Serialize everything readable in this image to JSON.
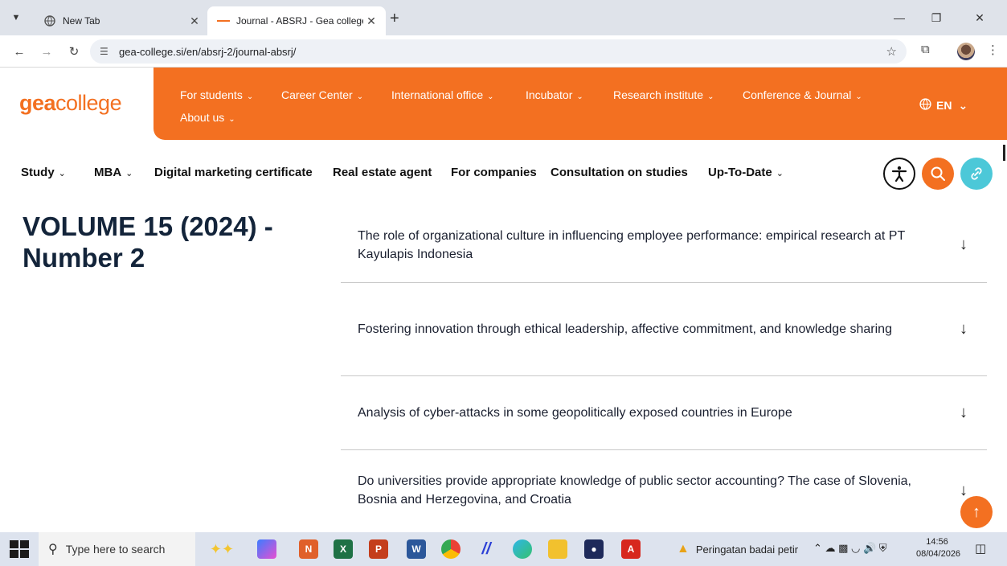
{
  "browser": {
    "tabs": [
      {
        "title": "New Tab"
      },
      {
        "title": "Journal - ABSRJ - Gea college"
      }
    ],
    "url": "gea-college.si/en/absrj-2/journal-absrj/"
  },
  "site": {
    "logo": {
      "part1": "gea",
      "part2": "college"
    },
    "main_nav": [
      "For students",
      "Career Center",
      "International office",
      "Incubator",
      "Research institute",
      "Conference & Journal",
      "About us"
    ],
    "language": "EN",
    "sub_nav": [
      "Study",
      "MBA",
      "Digital marketing certificate",
      "Real estate agent",
      "For companies",
      "Consultation on studies",
      "Up-To-Date"
    ],
    "colors": {
      "brand_orange": "#f37021",
      "link_teal": "#4cc8d8"
    }
  },
  "content": {
    "volume_title": "VOLUME 15 (2024) - Number 2",
    "articles": [
      "The role of organizational culture in influencing employee performance: empirical research at PT Kayulapis Indonesia",
      "Fostering innovation through ethical leadership, affective commitment, and knowledge sharing",
      "Analysis of cyber-attacks in some geopolitically exposed countries in Europe",
      "Do universities provide appropriate knowledge of public sector accounting? The case of Slovenia, Bosnia and Herzegovina, and Croatia"
    ]
  },
  "taskbar": {
    "search_placeholder": "Type here to search",
    "weather_text": "Peringatan badai petir",
    "time": "14:56",
    "date": "08/04/2026"
  }
}
